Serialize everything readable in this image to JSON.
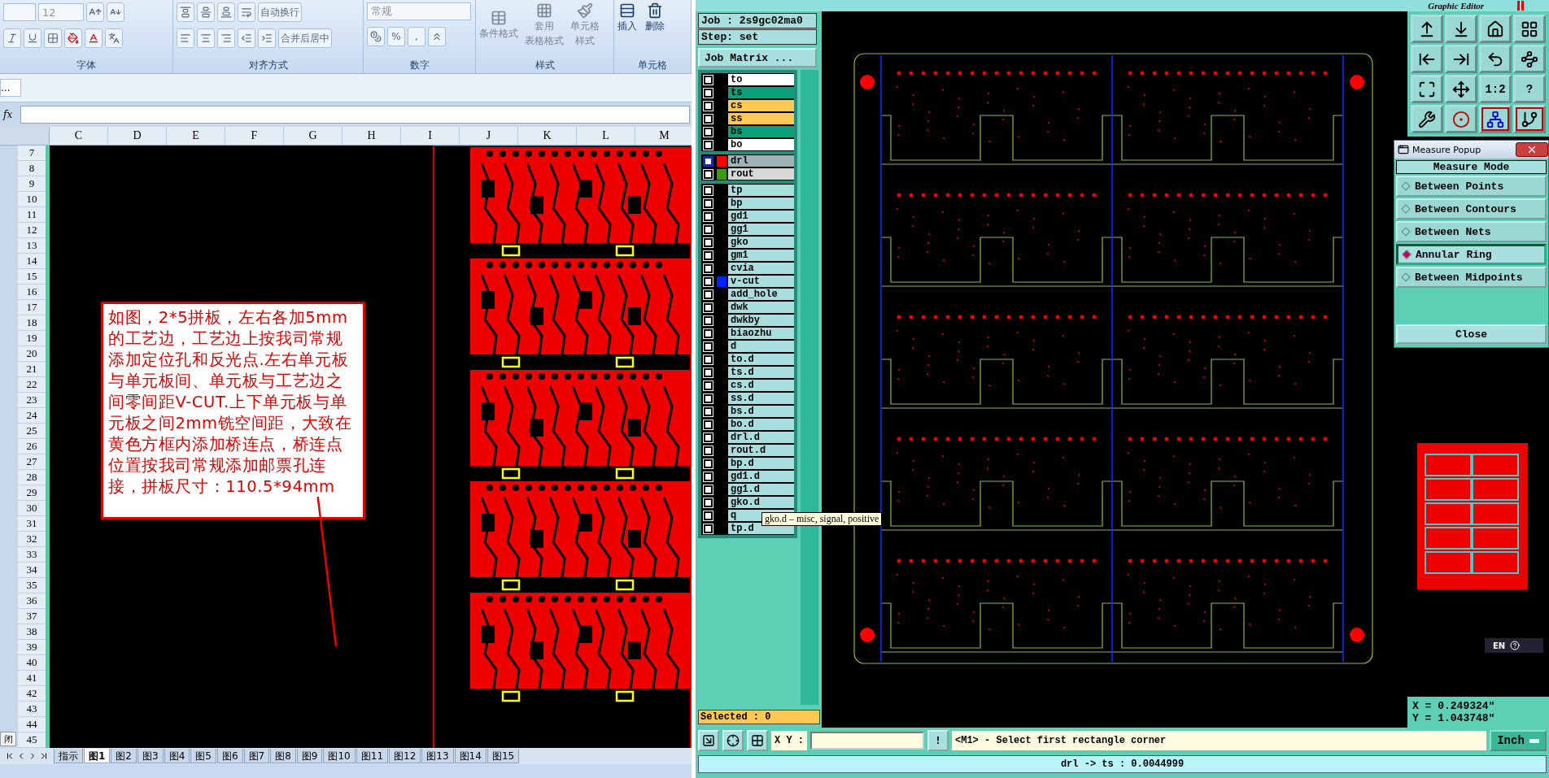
{
  "excel": {
    "ribbon": {
      "font_size": "12",
      "groups": [
        {
          "kind": "font",
          "label": "字体"
        },
        {
          "kind": "align",
          "label": "对齐方式",
          "wrap": "自动换行",
          "merge": "合并后居中"
        },
        {
          "kind": "number",
          "label": "数字",
          "format": "常规",
          "percent": "%",
          "comma": ","
        },
        {
          "kind": "styles",
          "label": "样式",
          "buttons": [
            [
              "条件格式"
            ],
            [
              "套用",
              "表格格式"
            ],
            [
              "单元格",
              "样式"
            ]
          ]
        },
        {
          "kind": "cells",
          "label": "单元格",
          "buttons": [
            "插入",
            "删除"
          ]
        }
      ]
    },
    "name_box": "...",
    "fx": "fx",
    "columns": [
      "C",
      "D",
      "E",
      "F",
      "G",
      "H",
      "I",
      "J",
      "K",
      "L",
      "M"
    ],
    "rows": [
      "7",
      "8",
      "9",
      "10",
      "11",
      "12",
      "13",
      "14",
      "15",
      "16",
      "17",
      "18",
      "19",
      "20",
      "21",
      "22",
      "23",
      "24",
      "25",
      "26",
      "27",
      "28",
      "29",
      "30",
      "31",
      "32",
      "33",
      "34",
      "35",
      "36",
      "37",
      "38",
      "39",
      "40",
      "41",
      "42",
      "43",
      "44",
      "45"
    ],
    "note": "如图，2*5拼板，左右各加5mm的工艺边，工艺边上按我司常规添加定位孔和反光点.左右单元板与单元板间、单元板与工艺边之间零间距V-CUT.上下单元板与单元板之间2mm铣空间距，大致在黄色方框内添加桥连点，桥连点位置按我司常规添加邮票孔连接，拼板尺寸：110.5*94mm",
    "side_button": "闭",
    "sheet_tabs": [
      {
        "label": "指示",
        "selected": false
      },
      {
        "label": "图1",
        "selected": true
      },
      {
        "label": "图2",
        "selected": false
      },
      {
        "label": "图3",
        "selected": false
      },
      {
        "label": "图4",
        "selected": false
      },
      {
        "label": "图5",
        "selected": false
      },
      {
        "label": "图6",
        "selected": false
      },
      {
        "label": "图7",
        "selected": false
      },
      {
        "label": "图8",
        "selected": false
      },
      {
        "label": "图9",
        "selected": false
      },
      {
        "label": "图10",
        "selected": false
      },
      {
        "label": "图11",
        "selected": false
      },
      {
        "label": "图12",
        "selected": false
      },
      {
        "label": "图13",
        "selected": false
      },
      {
        "label": "图14",
        "selected": false
      },
      {
        "label": "图15",
        "selected": false
      }
    ]
  },
  "genesis": {
    "title": "Graphic Editor",
    "job": "Job : 2s9gc02ma0",
    "step": "Step: set",
    "job_matrix": "Job Matrix ...",
    "layer_groups": [
      {
        "kind": "board",
        "layers": [
          {
            "name": "to",
            "color": "#ffffff",
            "checked": false
          },
          {
            "name": "ts",
            "color": "#0aa07a",
            "checked": false
          },
          {
            "name": "cs",
            "color": "#ffc852",
            "checked": false
          },
          {
            "name": "ss",
            "color": "#ffc852",
            "checked": false
          },
          {
            "name": "bs",
            "color": "#0aa07a",
            "checked": false
          },
          {
            "name": "bo",
            "color": "#ffffff",
            "checked": false
          }
        ]
      },
      {
        "kind": "drill",
        "layers": [
          {
            "name": "drl",
            "color": "#ff0000",
            "checked": false,
            "work": true
          },
          {
            "name": "rout",
            "color": "#3a9a10",
            "checked": false,
            "work": false
          }
        ]
      },
      {
        "kind": "misc",
        "layers": [
          {
            "name": "tp",
            "checked": false
          },
          {
            "name": "bp",
            "checked": false
          },
          {
            "name": "gd1",
            "checked": false
          },
          {
            "name": "gg1",
            "checked": false
          },
          {
            "name": "gko",
            "checked": false
          },
          {
            "name": "gm1",
            "checked": false
          },
          {
            "name": "cvia",
            "checked": false
          },
          {
            "name": "v-cut",
            "color": "#0022ff",
            "checked": false
          },
          {
            "name": "add_hole",
            "checked": false
          },
          {
            "name": "dwk",
            "checked": false
          },
          {
            "name": "dwkby",
            "checked": false
          },
          {
            "name": "biaozhu",
            "checked": false
          },
          {
            "name": "d",
            "checked": false
          },
          {
            "name": "to.d",
            "checked": false
          },
          {
            "name": "ts.d",
            "checked": false
          },
          {
            "name": "cs.d",
            "checked": false
          },
          {
            "name": "ss.d",
            "checked": false
          },
          {
            "name": "bs.d",
            "checked": false
          },
          {
            "name": "bo.d",
            "checked": false
          },
          {
            "name": "drl.d",
            "checked": false
          },
          {
            "name": "rout.d",
            "checked": false
          },
          {
            "name": "bp.d",
            "checked": false
          },
          {
            "name": "gd1.d",
            "checked": false
          },
          {
            "name": "gg1.d",
            "checked": false
          },
          {
            "name": "gko.d",
            "checked": false
          },
          {
            "name": "q",
            "checked": false
          },
          {
            "name": "tp.d",
            "checked": false
          }
        ]
      }
    ],
    "tooltip": "gko.d – misc, signal, positive",
    "selected_count": "Selected : 0",
    "zoom_button": "1:2",
    "help_button": "?",
    "measure_popup": {
      "title": "Measure Popup",
      "heading": "Measure Mode",
      "options": [
        {
          "label": "Between Points",
          "selected": false
        },
        {
          "label": "Between Contours",
          "selected": false
        },
        {
          "label": "Between Nets",
          "selected": false
        },
        {
          "label": "Annular Ring",
          "selected": true
        },
        {
          "label": "Between Midpoints",
          "selected": false
        }
      ],
      "close": "Close"
    },
    "language": "EN",
    "coords": {
      "x": "X = 0.249324\"",
      "y": "Y = 1.043748\""
    },
    "command": {
      "xy_label": "X Y :",
      "bang": "!",
      "message": "<M1> - Select first rectangle corner",
      "units": "Inch"
    },
    "status": "drl -> ts : 0.0044999"
  }
}
